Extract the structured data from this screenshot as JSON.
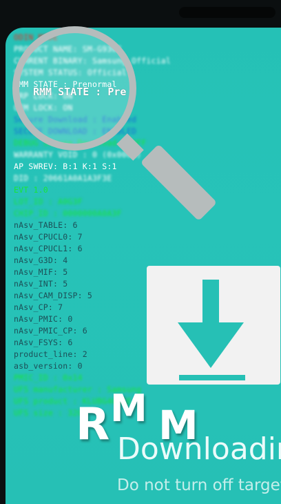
{
  "info_lines": [
    {
      "text": "ODIN MODE",
      "style": "red blur"
    },
    {
      "text": "PRODUCT NAME: SM-G930F",
      "style": "white blur"
    },
    {
      "text": "CURRENT BINARY: Samsung Official",
      "style": "white blur"
    },
    {
      "text": "SYSTEM STATUS: Official",
      "style": "white blur"
    },
    {
      "text": "RMM STATE : Prenormal",
      "style": "white"
    },
    {
      "text": "FRP LOCK: ON",
      "style": "white blur"
    },
    {
      "text": "OEM LOCK: ON",
      "style": "white blur"
    },
    {
      "text": "Secure Download : Enabled",
      "style": "blue blur"
    },
    {
      "text": "SECURE DOWNLOAD : ENABLED",
      "style": "blue blur"
    },
    {
      "text": "DEBUG Secure Download : OFF",
      "style": "green blur"
    },
    {
      "text": "WARRANTY VOID : 0 (0x0000)",
      "style": "white blur"
    },
    {
      "text": "AP SWREV: B:1 K:1 S:1",
      "style": "white"
    },
    {
      "text": "DID : 20661A0A1A3F3E",
      "style": "white blur"
    },
    {
      "text": "EVT 1.0",
      "style": "green"
    },
    {
      "text": "LOT_ID : A0G3F",
      "style": "green blur"
    },
    {
      "text": "CHIP_ID : 0000000A0A3F",
      "style": "green blur"
    },
    {
      "text": "nAsv_TABLE: 6",
      "style": "plain"
    },
    {
      "text": "nAsv_CPUCL0: 7",
      "style": "plain"
    },
    {
      "text": "nAsv_CPUCL1: 6",
      "style": "plain"
    },
    {
      "text": "nAsv_G3D: 4",
      "style": "plain"
    },
    {
      "text": "nAsv_MIF: 5",
      "style": "plain"
    },
    {
      "text": "nAsv_INT: 5",
      "style": "plain"
    },
    {
      "text": "nAsv_CAM_DISP: 5",
      "style": "plain"
    },
    {
      "text": "nAsv_CP: 7",
      "style": "plain"
    },
    {
      "text": "nAsv_PMIC: 0",
      "style": "plain"
    },
    {
      "text": "nAsv_PMIC_CP: 6",
      "style": "plain"
    },
    {
      "text": "nAsv_FSYS: 6",
      "style": "plain"
    },
    {
      "text": "product_line: 2",
      "style": "plain"
    },
    {
      "text": "asb_version: 0",
      "style": "plain"
    },
    {
      "text": "PMIC_ID : 0x14",
      "style": "green blur"
    },
    {
      "text": "UFS manufacturer : Samsung",
      "style": "green blur"
    },
    {
      "text": "UFS product : KLUBG4G1CE",
      "style": "green blur"
    },
    {
      "text": "UFS size : 32GB",
      "style": "green blur"
    }
  ],
  "magnifier": {
    "text": "RMM STATE : Pre"
  },
  "download_card": {
    "icon": "download-arrow-icon"
  },
  "rmm_overlay": {
    "r": "R",
    "m1": "M",
    "m2": "M"
  },
  "downloading_text": "Downloading",
  "subtitle_text": "Do not turn off target",
  "colors": {
    "background": "#26c0b5",
    "card": "#f2f2f2",
    "lens": "#b6bcbc"
  }
}
